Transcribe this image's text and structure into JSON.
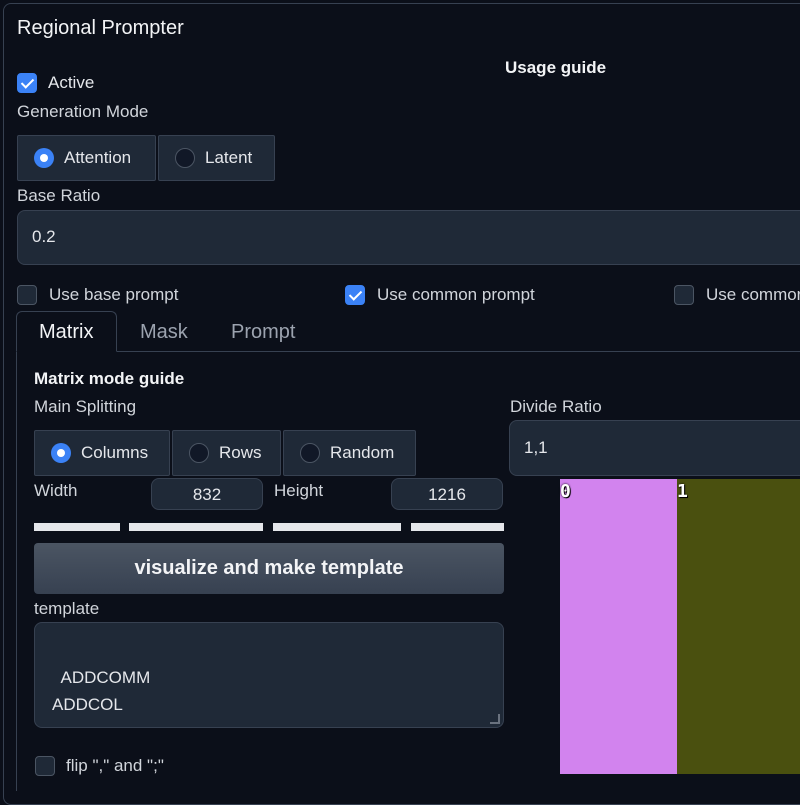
{
  "panel": {
    "title": "Regional Prompter",
    "usage_guide": "Usage guide"
  },
  "active": {
    "label": "Active",
    "checked": true
  },
  "generation_mode": {
    "label": "Generation Mode",
    "options": [
      "Attention",
      "Latent"
    ],
    "selected": "Attention"
  },
  "base_ratio": {
    "label": "Base Ratio",
    "value": "0.2"
  },
  "checkboxes": {
    "use_base_prompt": {
      "label": "Use base prompt",
      "checked": false
    },
    "use_common_prompt": {
      "label": "Use common prompt",
      "checked": true
    },
    "use_common_neg": {
      "label": "Use commor",
      "checked": false
    }
  },
  "tabs": {
    "matrix": "Matrix",
    "mask": "Mask",
    "prompt": "Prompt",
    "active": "Matrix"
  },
  "matrix": {
    "guide": "Matrix mode guide",
    "main_splitting": {
      "label": "Main Splitting",
      "options": [
        "Columns",
        "Rows",
        "Random"
      ],
      "selected": "Columns"
    },
    "width": {
      "label": "Width",
      "value": "832"
    },
    "height": {
      "label": "Height",
      "value": "1216"
    },
    "divide_ratio": {
      "label": "Divide Ratio",
      "value": "1,1"
    },
    "visualize_button": "visualize and make template",
    "template": {
      "label": "template",
      "value": "ADDCOMM\nADDCOL"
    },
    "flip": {
      "label": "flip \",\" and \";\"",
      "checked": false
    },
    "visualization": {
      "regions": [
        {
          "index": "0",
          "color": "#d283ee"
        },
        {
          "index": "1",
          "color": "#4a500f"
        }
      ]
    }
  }
}
